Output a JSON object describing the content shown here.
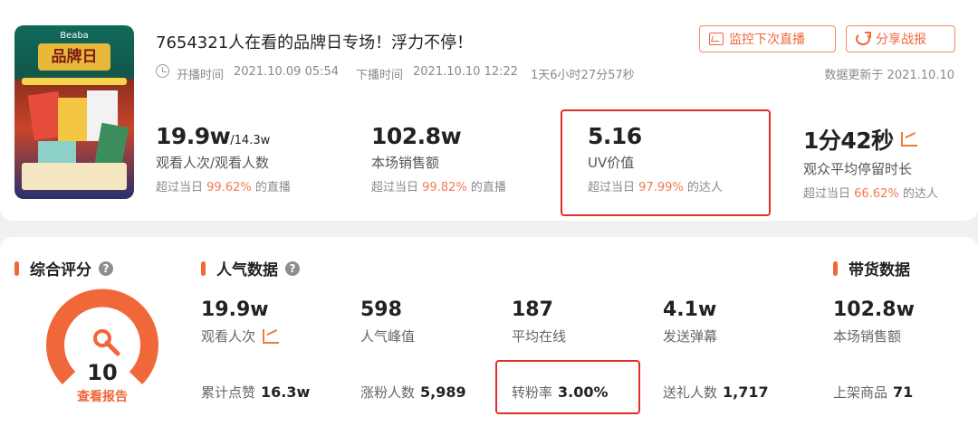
{
  "header": {
    "title": "7654321人在看的品牌日专场！浮力不停！",
    "start_label": "开播时间",
    "start_time": "2021.10.09 05:54",
    "end_label": "下播时间",
    "end_time": "2021.10.10 12:22",
    "duration": "1天6小时27分57秒",
    "updated": "数据更新于 2021.10.10",
    "monitor_button": "监控下次直播",
    "share_button": "分享战报",
    "thumbnail": {
      "brand": "Beaba",
      "logo": "品牌日"
    }
  },
  "stats": [
    {
      "value": "19.9w",
      "value_small": "/14.3w",
      "label": "观看人次/观看人数",
      "sub_prefix": "超过当日",
      "pct": "99.62%",
      "sub_suffix": "的直播"
    },
    {
      "value": "102.8w",
      "label": "本场销售额",
      "sub_prefix": "超过当日",
      "pct": "99.82%",
      "sub_suffix": "的直播"
    },
    {
      "value": "5.16",
      "label": "UV价值",
      "sub_prefix": "超过当日",
      "pct": "97.99%",
      "sub_suffix": "的达人"
    },
    {
      "value": "1分42秒",
      "label": "观众平均停留时长",
      "sub_prefix": "超过当日",
      "pct": "66.62%",
      "sub_suffix": "的达人"
    }
  ],
  "score": {
    "title": "综合评分",
    "value": "10",
    "level": 1.0,
    "report_link": "查看报告"
  },
  "popularity": {
    "title": "人气数据",
    "metrics": [
      {
        "value": "19.9w",
        "label": "观看人次"
      },
      {
        "value": "598",
        "label": "人气峰值"
      },
      {
        "value": "187",
        "label": "平均在线"
      },
      {
        "value": "4.1w",
        "label": "发送弹幕"
      }
    ],
    "secondary": [
      {
        "label": "累计点赞",
        "value": "16.3w"
      },
      {
        "label": "涨粉人数",
        "value": "5,989"
      },
      {
        "label": "转粉率",
        "value": "3.00%"
      },
      {
        "label": "送礼人数",
        "value": "1,717"
      }
    ]
  },
  "sales": {
    "title": "带货数据",
    "metric": {
      "value": "102.8w",
      "label": "本场销售额"
    },
    "secondary": {
      "label": "上架商品",
      "value": "71"
    }
  },
  "colors": {
    "accent": "#f0673a",
    "highlight_border": "#e02f26",
    "percent": "#f07a55"
  }
}
